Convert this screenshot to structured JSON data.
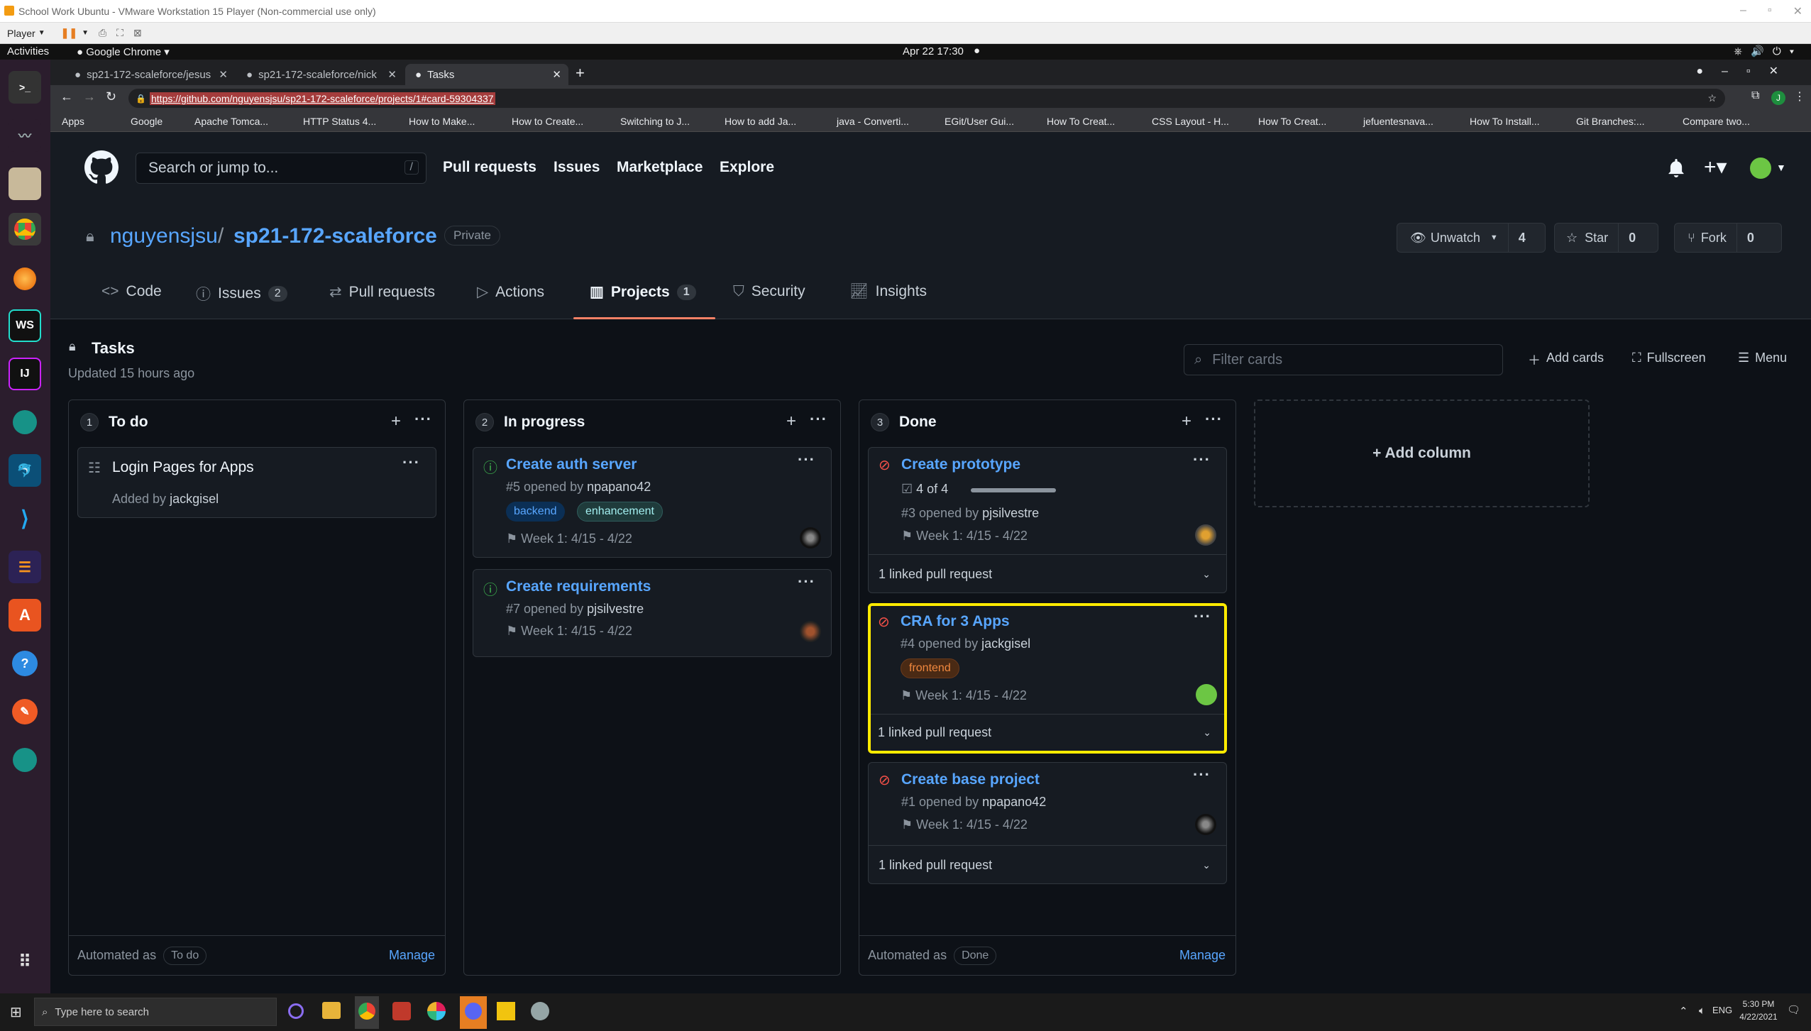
{
  "vm": {
    "title": "School Work Ubuntu - VMware Workstation 15 Player (Non-commercial use only)",
    "player_label": "Player"
  },
  "gnome": {
    "activities": "Activities",
    "app": "Google Chrome",
    "clock": "Apr 22  17:30"
  },
  "browser": {
    "tabs": [
      {
        "label": "sp21-172-scaleforce/jesus"
      },
      {
        "label": "sp21-172-scaleforce/nick"
      },
      {
        "label": "Tasks"
      }
    ],
    "url": "https://github.com/nguyensjsu/sp21-172-scaleforce/projects/1#card-59304337",
    "bookmarks": [
      "Apps",
      "Google",
      "Apache Tomca...",
      "HTTP Status 4...",
      "How to Make...",
      "How to Create...",
      "Switching to J...",
      "How to add Ja...",
      "java - Converti...",
      "EGit/User Gui...",
      "How To Creat...",
      "CSS Layout - H...",
      "How To Creat...",
      "jefuentesnava...",
      "How To Install...",
      "Git Branches:...",
      "Compare two..."
    ]
  },
  "github": {
    "search_placeholder": "Search or jump to...",
    "search_key": "/",
    "nav": [
      "Pull requests",
      "Issues",
      "Marketplace",
      "Explore"
    ],
    "owner": "nguyensjsu",
    "separator": "/",
    "repo": "sp21-172-scaleforce",
    "visibility": "Private",
    "watch": {
      "label": "Unwatch",
      "count": "4"
    },
    "star": {
      "label": "Star",
      "count": "0"
    },
    "fork": {
      "label": "Fork",
      "count": "0"
    },
    "tabs": [
      {
        "label": "Code",
        "count": ""
      },
      {
        "label": "Issues",
        "count": "2"
      },
      {
        "label": "Pull requests",
        "count": ""
      },
      {
        "label": "Actions",
        "count": ""
      },
      {
        "label": "Projects",
        "count": "1"
      },
      {
        "label": "Security",
        "count": ""
      },
      {
        "label": "Insights",
        "count": ""
      }
    ],
    "accent": "#f78166"
  },
  "project": {
    "name": "Tasks",
    "updated": "Updated 15 hours ago",
    "filter_placeholder": "Filter cards",
    "add_cards": "Add cards",
    "fullscreen": "Fullscreen",
    "menu": "Menu",
    "add_column": "+ Add column",
    "columns": [
      {
        "count": "1",
        "name": "To do",
        "automated_as": "Automated as",
        "automation": "To do",
        "manage": "Manage",
        "cards": [
          {
            "title": "Login Pages for Apps",
            "added_by_prefix": "Added by",
            "added_by": "jackgisel"
          }
        ]
      },
      {
        "count": "2",
        "name": "In progress",
        "cards": [
          {
            "title": "Create auth server",
            "number": "#5 opened by",
            "author": "npapano42",
            "labels": [
              "backend",
              "enhancement"
            ],
            "milestone": "Week 1: 4/15 - 4/22"
          },
          {
            "title": "Create requirements",
            "number": "#7 opened by",
            "author": "pjsilvestre",
            "milestone": "Week 1: 4/15 - 4/22"
          }
        ]
      },
      {
        "count": "3",
        "name": "Done",
        "automated_as": "Automated as",
        "automation": "Done",
        "manage": "Manage",
        "cards": [
          {
            "title": "Create prototype",
            "progress_text": "4 of 4",
            "progress": 1.0,
            "number": "#3 opened by",
            "author": "pjsilvestre",
            "milestone": "Week 1: 4/15 - 4/22",
            "linked": "1 linked pull request"
          },
          {
            "title": "CRA for 3 Apps",
            "number": "#4 opened by",
            "author": "jackgisel",
            "labels": [
              "frontend"
            ],
            "milestone": "Week 1: 4/15 - 4/22",
            "linked": "1 linked pull request",
            "highlight": "#ffeb00"
          },
          {
            "title": "Create base project",
            "number": "#1 opened by",
            "author": "npapano42",
            "milestone": "Week 1: 4/15 - 4/22",
            "linked": "1 linked pull request"
          }
        ]
      }
    ]
  },
  "taskbar": {
    "search_placeholder": "Type here to search",
    "lang": "ENG",
    "time": "5:30 PM",
    "date": "4/22/2021"
  }
}
